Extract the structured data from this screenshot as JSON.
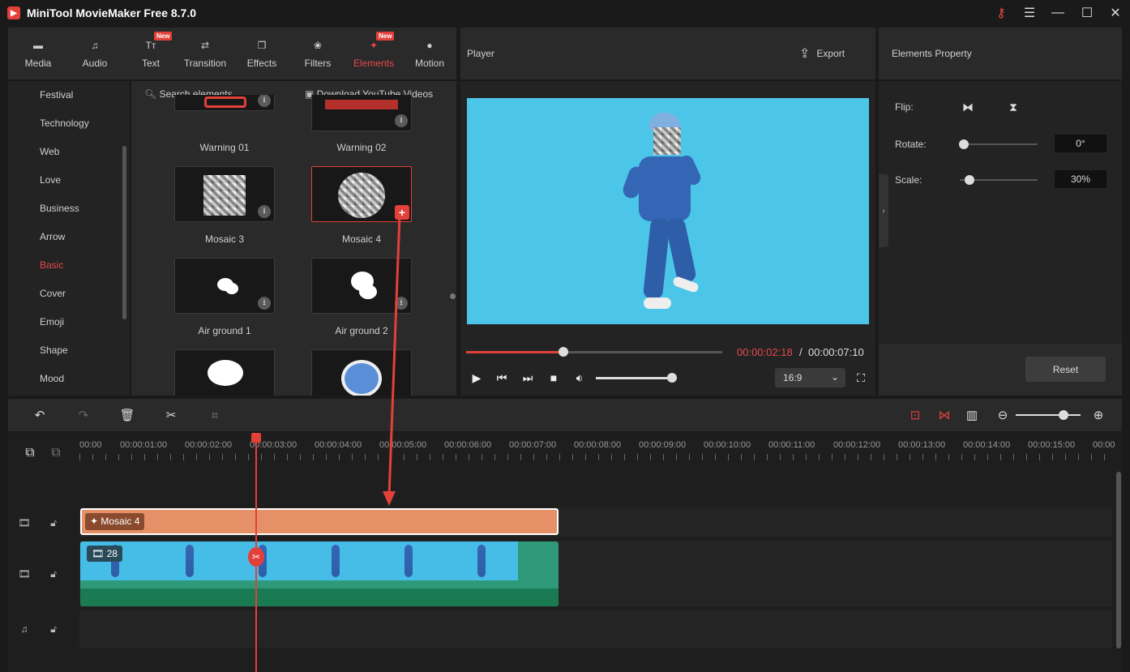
{
  "app": {
    "title": "MiniTool MovieMaker Free 8.7.0"
  },
  "window": {
    "key_icon": "key-icon",
    "menu_icon": "menu-icon",
    "minimize": "—",
    "maximize": "☐",
    "close": "✕"
  },
  "tabs": [
    {
      "label": "Media",
      "icon": "media-icon",
      "glyph": "▬"
    },
    {
      "label": "Audio",
      "icon": "music-note-icon",
      "glyph": "♫"
    },
    {
      "label": "Text",
      "icon": "text-icon",
      "glyph": "Tт",
      "badge": "New"
    },
    {
      "label": "Transition",
      "icon": "transition-icon",
      "glyph": "⇄"
    },
    {
      "label": "Effects",
      "icon": "effects-icon",
      "glyph": "❐"
    },
    {
      "label": "Filters",
      "icon": "filters-icon",
      "glyph": "❀"
    },
    {
      "label": "Elements",
      "icon": "elements-icon",
      "glyph": "✦",
      "badge": "New",
      "active": true
    },
    {
      "label": "Motion",
      "icon": "motion-icon",
      "glyph": "●"
    }
  ],
  "categories": [
    "Festival",
    "Technology",
    "Web",
    "Love",
    "Business",
    "Arrow",
    "Basic",
    "Cover",
    "Emoji",
    "Shape",
    "Mood"
  ],
  "active_category": "Basic",
  "elements_panel": {
    "search_placeholder": "Search elements",
    "download_link": "Download YouTube Videos",
    "items": [
      "Warning 01",
      "Warning 02",
      "Mosaic 3",
      "Mosaic 4",
      "Air ground 1",
      "Air ground 2"
    ]
  },
  "player": {
    "title": "Player",
    "export_label": "Export",
    "current_time": "00:00:02:18",
    "separator": " / ",
    "total_time": "00:00:07:10",
    "progress": 0.38,
    "volume": 0.9,
    "aspect_ratio": "16:9",
    "preview_bg": "#4bc6e8"
  },
  "properties": {
    "title": "Elements Property",
    "flip_label": "Flip:",
    "rotate_label": "Rotate:",
    "rotate_value": "0°",
    "scale_label": "Scale:",
    "scale_value": "30%",
    "reset_label": "Reset"
  },
  "timeline": {
    "ticks": [
      "00:00",
      "00:00:01:00",
      "00:00:02:00",
      "00:00:03:00",
      "00:00:04:00",
      "00:00:05:00",
      "00:00:06:00",
      "00:00:07:00",
      "00:00:08:00",
      "00:00:09:00",
      "00:00:10:00",
      "00:00:11:00",
      "00:00:12:00",
      "00:00:13:00",
      "00:00:14:00",
      "00:00:15:00",
      "00:00"
    ],
    "element_clip": "Mosaic 4",
    "video_clip_count": "28",
    "zoom": 0.7,
    "accent": "#e3403a"
  }
}
